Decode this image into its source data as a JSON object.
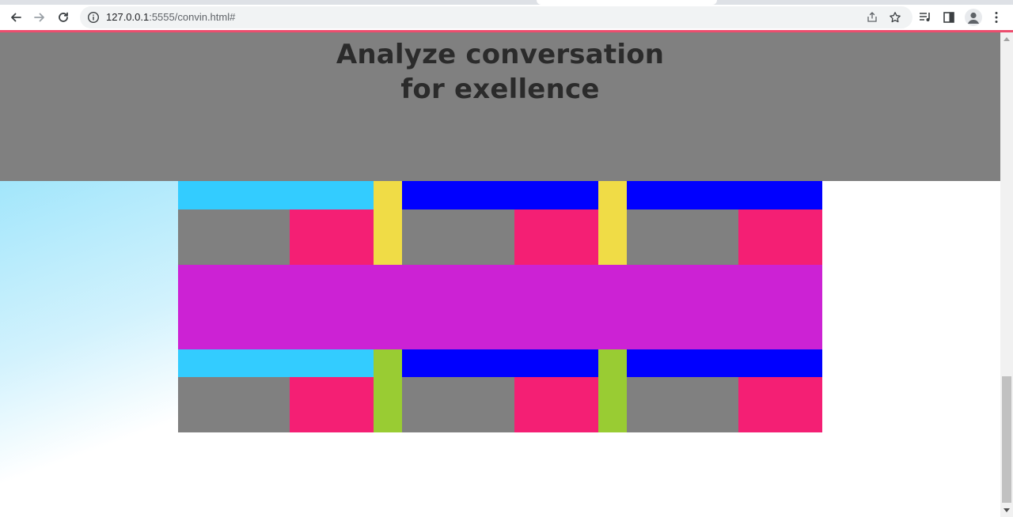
{
  "browser": {
    "url_host": "127.0.0.1",
    "url_rest": ":5555/convin.html#",
    "accent_color": "#ed4d6e"
  },
  "icons": {
    "back": "back-arrow-icon",
    "forward": "forward-arrow-icon",
    "reload": "reload-icon",
    "info": "info-icon",
    "share": "share-icon",
    "bookmark": "star-icon",
    "media": "media-queue-icon",
    "sidepanel": "side-panel-icon",
    "profile": "profile-avatar-icon",
    "menu": "kebab-menu-icon"
  },
  "hero": {
    "title_line1": "Analyze conversation",
    "title_line2": "for exellence",
    "background": "#808080",
    "text_color": "#2b2b2b"
  },
  "palette": {
    "sky": "#33ccff",
    "blue": "#0000ff",
    "yellow": "#f0dc46",
    "pink": "#f41f74",
    "gray": "#808080",
    "magenta": "#cc22d4",
    "lime": "#99cc33"
  }
}
